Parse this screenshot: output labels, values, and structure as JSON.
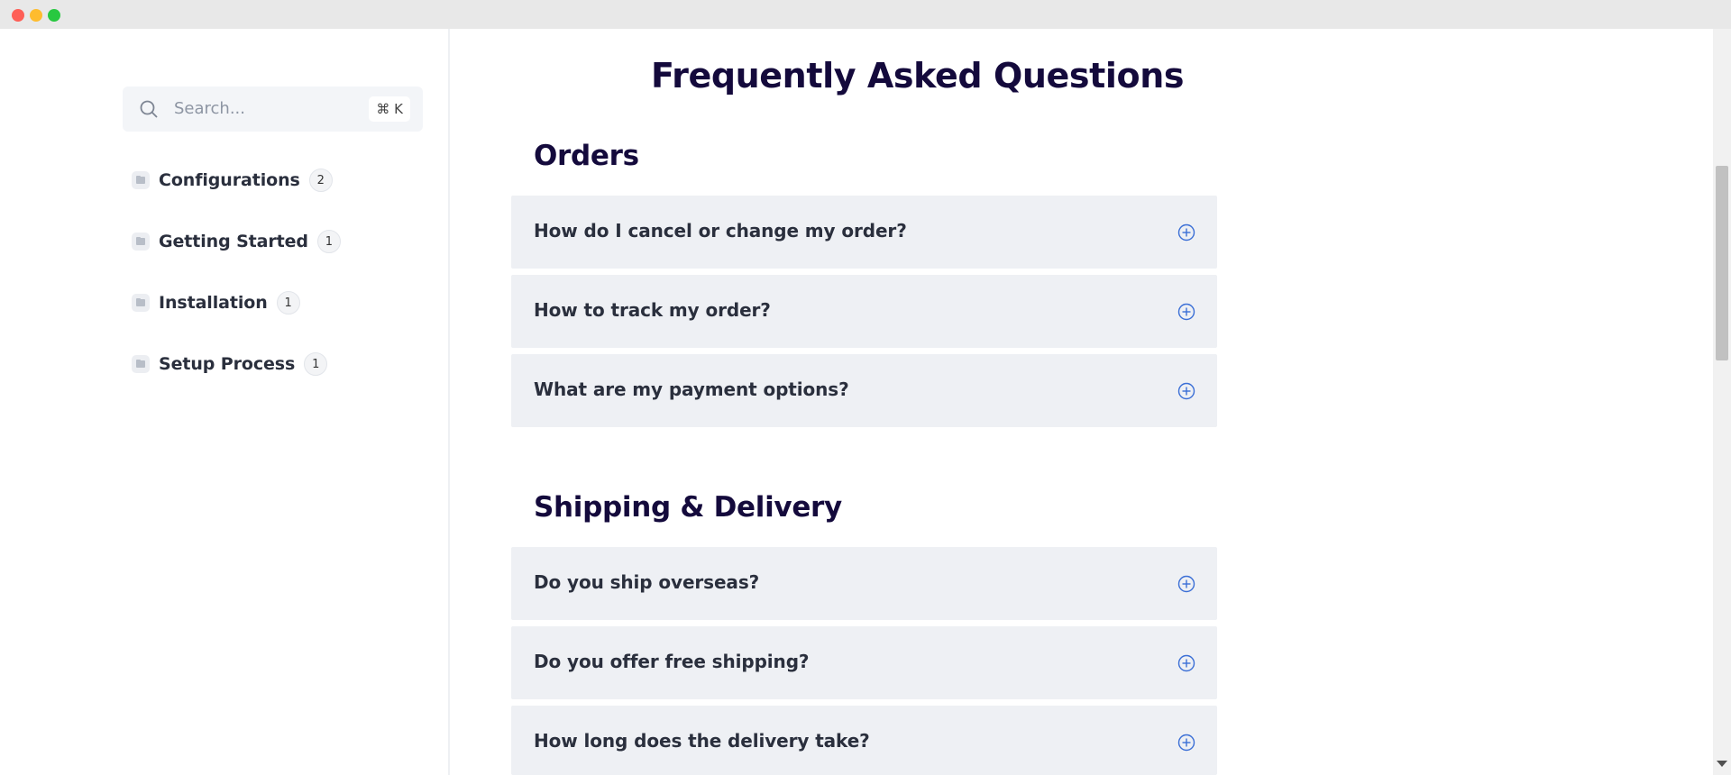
{
  "window": {
    "controls": [
      "close",
      "minimize",
      "maximize"
    ]
  },
  "sidebar": {
    "search": {
      "placeholder": "Search...",
      "shortcut": "⌘ K"
    },
    "items": [
      {
        "label": "Configurations",
        "count": "2",
        "icon": "folder-icon"
      },
      {
        "label": "Getting Started",
        "count": "1",
        "icon": "folder-icon"
      },
      {
        "label": "Installation",
        "count": "1",
        "icon": "folder-icon"
      },
      {
        "label": "Setup Process",
        "count": "1",
        "icon": "folder-icon"
      }
    ]
  },
  "main": {
    "title": "Frequently Asked Questions",
    "sections": [
      {
        "title": "Orders",
        "questions": [
          "How do I cancel or change my order?",
          "How to track my order?",
          "What are my payment options?"
        ]
      },
      {
        "title": "Shipping & Delivery",
        "questions": [
          "Do you ship overseas?",
          "Do you offer free shipping?",
          "How long does the delivery take?"
        ]
      }
    ]
  },
  "colors": {
    "heading": "#140a3c",
    "accent": "#3b6fd6",
    "card_bg": "#eef0f4",
    "titlebar": "#e8e8e8"
  }
}
